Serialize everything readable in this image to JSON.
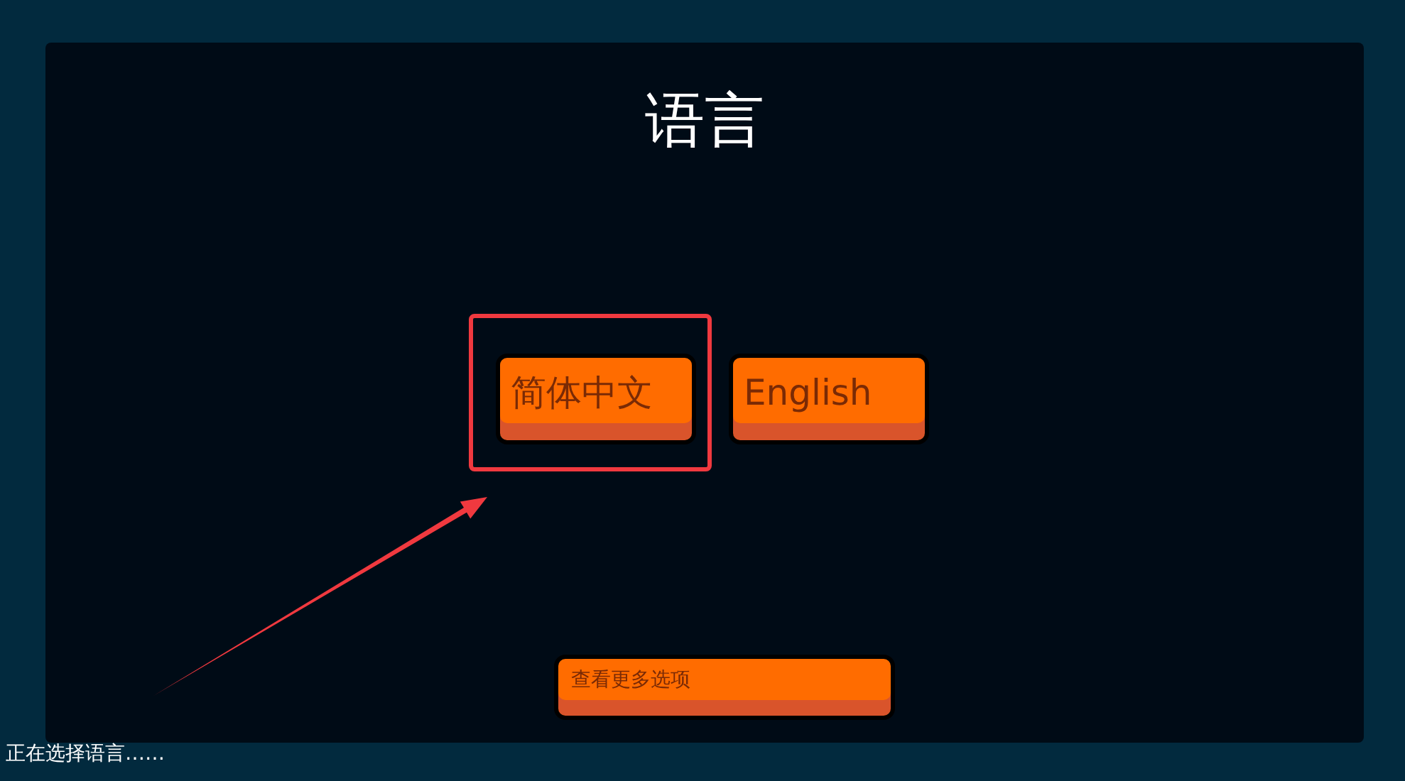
{
  "title": "语言",
  "languages": [
    {
      "label": "简体中文",
      "highlighted": true
    },
    {
      "label": "English",
      "highlighted": false
    }
  ],
  "more_button": "查看更多选项",
  "status_text": "正在选择语言……"
}
